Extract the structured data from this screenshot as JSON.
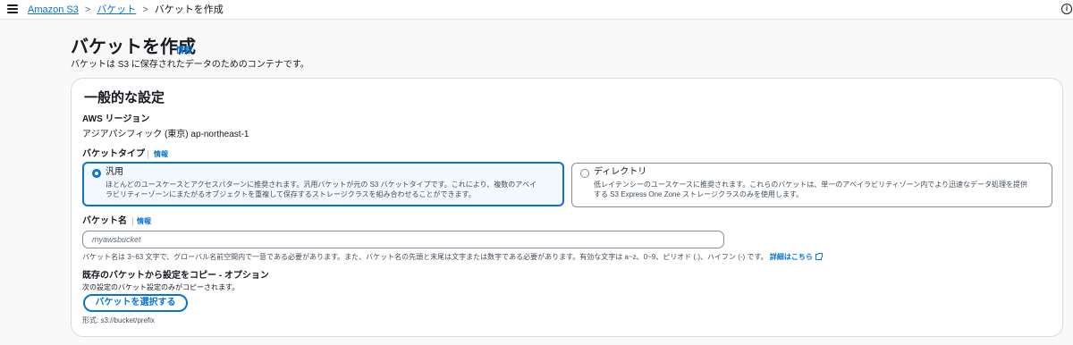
{
  "breadcrumb": {
    "item1": "Amazon S3",
    "item2": "バケット",
    "current": "バケットを作成"
  },
  "header": {
    "title": "バケットを作成",
    "info": "情報",
    "description": "バケットは S3 に保存されたデータのためのコンテナです。"
  },
  "general": {
    "section_title": "一般的な設定",
    "region_label": "AWS リージョン",
    "region_value": "アジアパシフィック (東京) ap-northeast-1",
    "bucket_type_label": "バケットタイプ",
    "bucket_type_info": "情報",
    "options": [
      {
        "title": "汎用",
        "desc_line1": "ほとんどのユースケースとアクセスパターンに推奨されます。汎用バケットが元の S3 バケットタイプです。これにより、複数のアベイ",
        "desc_line2": "ラビリティーゾーンにまたがるオブジェクトを重複して保存するストレージクラスを組み合わせることができます。"
      },
      {
        "title": "ディレクトリ",
        "desc_line1": "低レイテンシーのユースケースに推奨されます。これらのバケットは、単一のアベイラビリティゾーン内でより迅速なデータ処理を提供",
        "desc_line2": "する S3 Express One Zone ストレージクラスのみを使用します。"
      }
    ],
    "bucket_name_label": "バケット名",
    "bucket_name_info": "情報",
    "bucket_name_placeholder": "myawsbucket",
    "bucket_name_hint": "バケット名は 3~63 文字で、グローバル名前空間内で一意である必要があります。また、バケット名の先頭と末尾は文字または数字である必要があります。有効な文字は a~z、0~9、ピリオド (.)、ハイフン (-) です。",
    "details_link": "詳細はこちら",
    "copy_label": "既存のバケットから設定をコピー - オプション",
    "copy_desc": "次の設定のバケット設定のみがコピーされます。",
    "choose_bucket_button": "バケットを選択する",
    "format_hint": "形式: s3://bucket/prefix"
  },
  "colors": {
    "accent": "#0972d3",
    "text": "#16191f",
    "border": "#8c8c94"
  }
}
